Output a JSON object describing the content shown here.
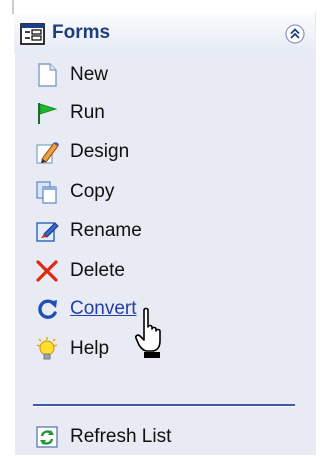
{
  "header": {
    "title": "Forms",
    "icon": "form-icon",
    "collapse_icon": "double-chevron-up-icon"
  },
  "items": [
    {
      "label": "New",
      "icon": "new-document-icon"
    },
    {
      "label": "Run",
      "icon": "green-flag-icon"
    },
    {
      "label": "Design",
      "icon": "pencil-edit-icon"
    },
    {
      "label": "Copy",
      "icon": "copy-icon"
    },
    {
      "label": "Rename",
      "icon": "rename-icon"
    },
    {
      "label": "Delete",
      "icon": "red-x-icon"
    },
    {
      "label": "Convert",
      "icon": "convert-arrow-icon",
      "hovered": true
    },
    {
      "label": "Help",
      "icon": "lightbulb-icon"
    }
  ],
  "footer_items": [
    {
      "label": "Refresh List",
      "icon": "refresh-icon"
    }
  ],
  "colors": {
    "panel_bg": "#e8ebf3",
    "header_text": "#1f3e7a",
    "link": "#2340a8",
    "separator": "#3a5ca8"
  },
  "cursor": "hand-pointer-icon"
}
